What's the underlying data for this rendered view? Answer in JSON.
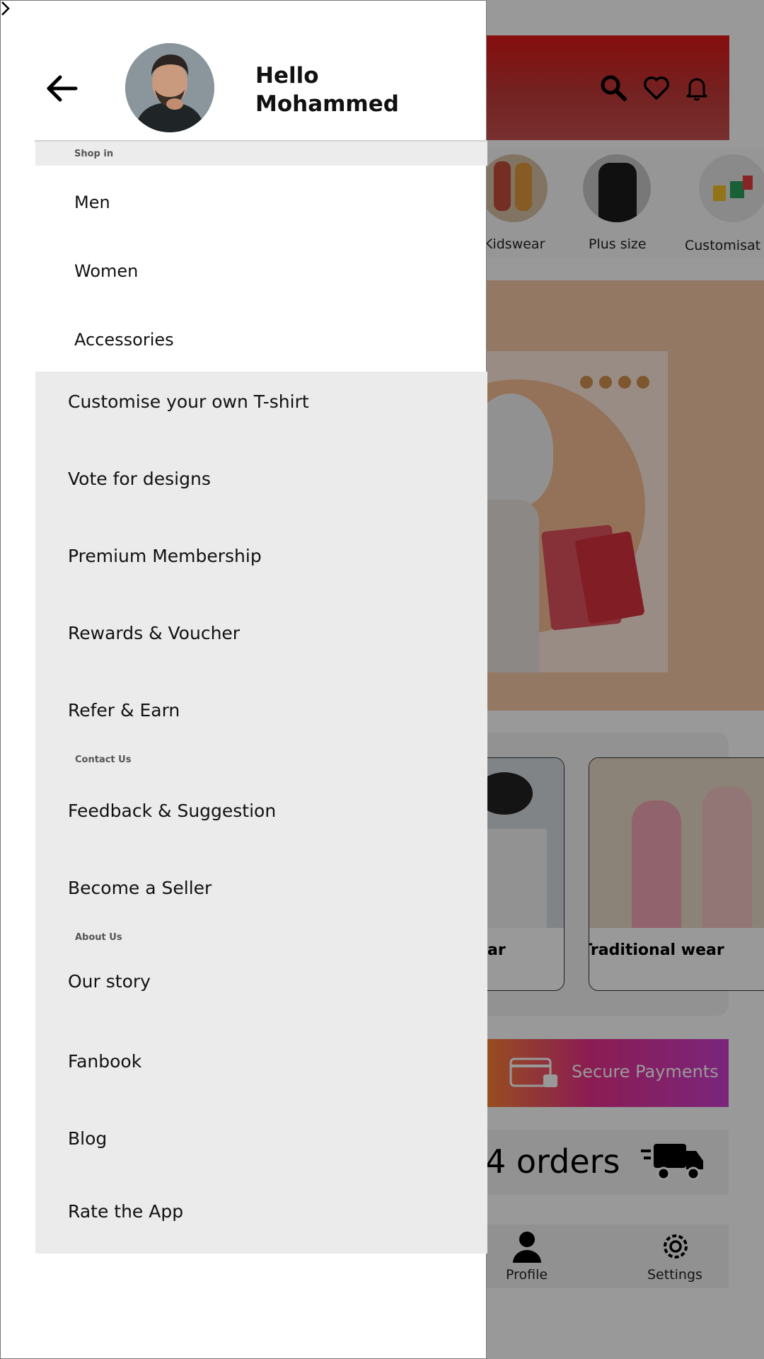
{
  "drawer": {
    "greeting_line1": "Hello",
    "greeting_line2": "Mohammed",
    "back_icon": "arrow-left-icon",
    "sections": {
      "shop_in": "Shop in",
      "contact_us": "Contact Us",
      "about_us": "About Us"
    },
    "shop_items": [
      "Men",
      "Women",
      "Accessories"
    ],
    "menu_items": [
      "Customise your own T-shirt",
      "Vote for designs",
      "Premium Membership",
      "Rewards & Voucher",
      "Refer & Earn",
      "Feedback & Suggestion",
      "Become a Seller",
      "Our story",
      "Fanbook",
      "Blog",
      "Rate the App"
    ]
  },
  "background_app": {
    "header_icons": [
      "search-icon",
      "heart-icon",
      "bell-icon"
    ],
    "categories": [
      "Kidswear",
      "Plus size",
      "Customisat"
    ],
    "wear_cards": [
      "ar",
      "Traditional wear"
    ],
    "secure_payments": "Secure Payments",
    "orders_text": "4 orders",
    "nav": [
      "Profile",
      "Settings"
    ]
  },
  "colors": {
    "overlay": "#000000",
    "drawer_gray": "#ebebeb",
    "header_red": "#e01818"
  }
}
